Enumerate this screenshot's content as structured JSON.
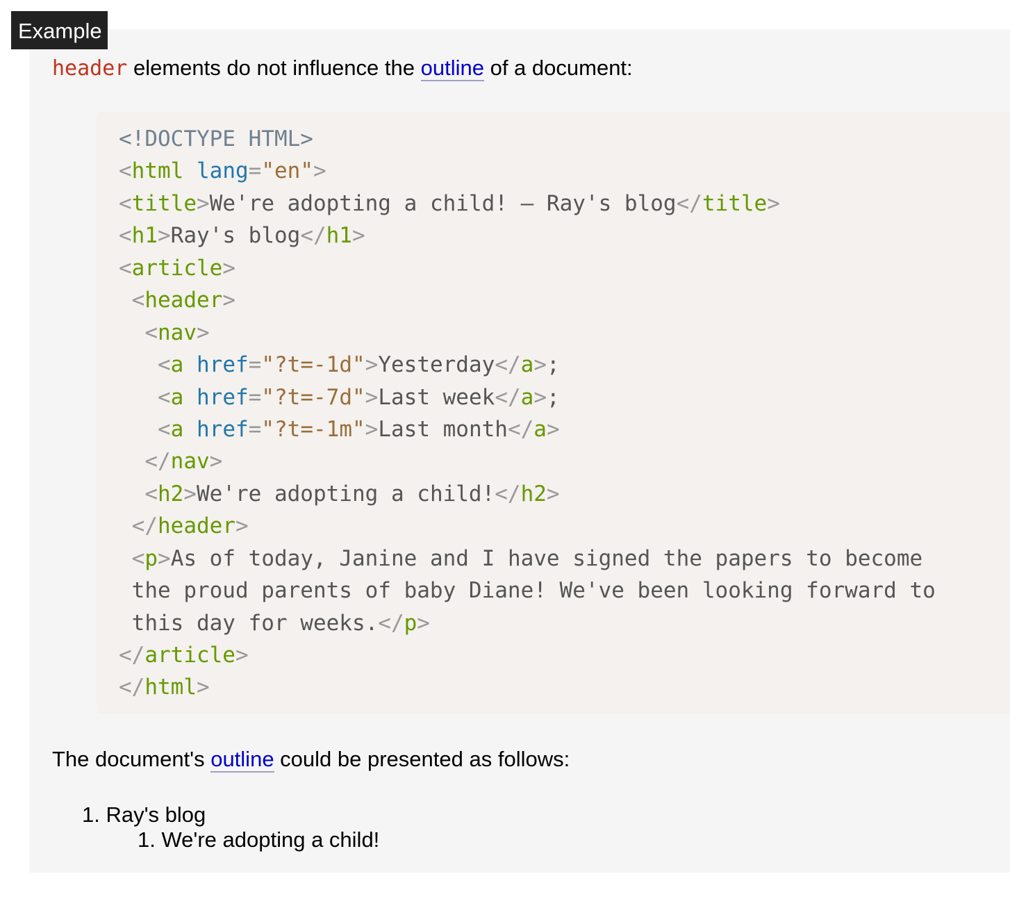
{
  "example_label": "Example",
  "intro": {
    "code_word": "header",
    "text_before_link": " elements do not influence the ",
    "link": "outline",
    "text_after_link": " of a document:"
  },
  "code_lines": [
    [
      {
        "c": "c-doc",
        "t": "<!DOCTYPE HTML>"
      }
    ],
    [
      {
        "c": "c-p",
        "t": "<"
      },
      {
        "c": "c-tag",
        "t": "html"
      },
      {
        "c": "c-txt",
        "t": " "
      },
      {
        "c": "c-attr",
        "t": "lang"
      },
      {
        "c": "c-p",
        "t": "="
      },
      {
        "c": "c-val",
        "t": "\"en\""
      },
      {
        "c": "c-p",
        "t": ">"
      }
    ],
    [
      {
        "c": "c-p",
        "t": "<"
      },
      {
        "c": "c-tag",
        "t": "title"
      },
      {
        "c": "c-p",
        "t": ">"
      },
      {
        "c": "c-txt",
        "t": "We're adopting a child! — Ray's blog"
      },
      {
        "c": "c-p",
        "t": "</"
      },
      {
        "c": "c-tag",
        "t": "title"
      },
      {
        "c": "c-p",
        "t": ">"
      }
    ],
    [
      {
        "c": "c-p",
        "t": "<"
      },
      {
        "c": "c-tag",
        "t": "h1"
      },
      {
        "c": "c-p",
        "t": ">"
      },
      {
        "c": "c-txt",
        "t": "Ray's blog"
      },
      {
        "c": "c-p",
        "t": "</"
      },
      {
        "c": "c-tag",
        "t": "h1"
      },
      {
        "c": "c-p",
        "t": ">"
      }
    ],
    [
      {
        "c": "c-p",
        "t": "<"
      },
      {
        "c": "c-tag",
        "t": "article"
      },
      {
        "c": "c-p",
        "t": ">"
      }
    ],
    [
      {
        "c": "c-txt",
        "t": " "
      },
      {
        "c": "c-p",
        "t": "<"
      },
      {
        "c": "c-tag",
        "t": "header"
      },
      {
        "c": "c-p",
        "t": ">"
      }
    ],
    [
      {
        "c": "c-txt",
        "t": "  "
      },
      {
        "c": "c-p",
        "t": "<"
      },
      {
        "c": "c-tag",
        "t": "nav"
      },
      {
        "c": "c-p",
        "t": ">"
      }
    ],
    [
      {
        "c": "c-txt",
        "t": "   "
      },
      {
        "c": "c-p",
        "t": "<"
      },
      {
        "c": "c-tag",
        "t": "a"
      },
      {
        "c": "c-txt",
        "t": " "
      },
      {
        "c": "c-attr",
        "t": "href"
      },
      {
        "c": "c-p",
        "t": "="
      },
      {
        "c": "c-val",
        "t": "\"?t=-1d\""
      },
      {
        "c": "c-p",
        "t": ">"
      },
      {
        "c": "c-txt",
        "t": "Yesterday"
      },
      {
        "c": "c-p",
        "t": "</"
      },
      {
        "c": "c-tag",
        "t": "a"
      },
      {
        "c": "c-p",
        "t": ">"
      },
      {
        "c": "c-txt",
        "t": ";"
      }
    ],
    [
      {
        "c": "c-txt",
        "t": "   "
      },
      {
        "c": "c-p",
        "t": "<"
      },
      {
        "c": "c-tag",
        "t": "a"
      },
      {
        "c": "c-txt",
        "t": " "
      },
      {
        "c": "c-attr",
        "t": "href"
      },
      {
        "c": "c-p",
        "t": "="
      },
      {
        "c": "c-val",
        "t": "\"?t=-7d\""
      },
      {
        "c": "c-p",
        "t": ">"
      },
      {
        "c": "c-txt",
        "t": "Last week"
      },
      {
        "c": "c-p",
        "t": "</"
      },
      {
        "c": "c-tag",
        "t": "a"
      },
      {
        "c": "c-p",
        "t": ">"
      },
      {
        "c": "c-txt",
        "t": ";"
      }
    ],
    [
      {
        "c": "c-txt",
        "t": "   "
      },
      {
        "c": "c-p",
        "t": "<"
      },
      {
        "c": "c-tag",
        "t": "a"
      },
      {
        "c": "c-txt",
        "t": " "
      },
      {
        "c": "c-attr",
        "t": "href"
      },
      {
        "c": "c-p",
        "t": "="
      },
      {
        "c": "c-val",
        "t": "\"?t=-1m\""
      },
      {
        "c": "c-p",
        "t": ">"
      },
      {
        "c": "c-txt",
        "t": "Last month"
      },
      {
        "c": "c-p",
        "t": "</"
      },
      {
        "c": "c-tag",
        "t": "a"
      },
      {
        "c": "c-p",
        "t": ">"
      }
    ],
    [
      {
        "c": "c-txt",
        "t": "  "
      },
      {
        "c": "c-p",
        "t": "</"
      },
      {
        "c": "c-tag",
        "t": "nav"
      },
      {
        "c": "c-p",
        "t": ">"
      }
    ],
    [
      {
        "c": "c-txt",
        "t": "  "
      },
      {
        "c": "c-p",
        "t": "<"
      },
      {
        "c": "c-tag",
        "t": "h2"
      },
      {
        "c": "c-p",
        "t": ">"
      },
      {
        "c": "c-txt",
        "t": "We're adopting a child!"
      },
      {
        "c": "c-p",
        "t": "</"
      },
      {
        "c": "c-tag",
        "t": "h2"
      },
      {
        "c": "c-p",
        "t": ">"
      }
    ],
    [
      {
        "c": "c-txt",
        "t": " "
      },
      {
        "c": "c-p",
        "t": "</"
      },
      {
        "c": "c-tag",
        "t": "header"
      },
      {
        "c": "c-p",
        "t": ">"
      }
    ],
    [
      {
        "c": "c-txt",
        "t": " "
      },
      {
        "c": "c-p",
        "t": "<"
      },
      {
        "c": "c-tag",
        "t": "p"
      },
      {
        "c": "c-p",
        "t": ">"
      },
      {
        "c": "c-txt",
        "t": "As of today, Janine and I have signed the papers to become"
      }
    ],
    [
      {
        "c": "c-txt",
        "t": " the proud parents of baby Diane! We've been looking forward to"
      }
    ],
    [
      {
        "c": "c-txt",
        "t": " this day for weeks."
      },
      {
        "c": "c-p",
        "t": "</"
      },
      {
        "c": "c-tag",
        "t": "p"
      },
      {
        "c": "c-p",
        "t": ">"
      }
    ],
    [
      {
        "c": "c-p",
        "t": "</"
      },
      {
        "c": "c-tag",
        "t": "article"
      },
      {
        "c": "c-p",
        "t": ">"
      }
    ],
    [
      {
        "c": "c-p",
        "t": "</"
      },
      {
        "c": "c-tag",
        "t": "html"
      },
      {
        "c": "c-p",
        "t": ">"
      }
    ]
  ],
  "outline_intro": {
    "text_before_link": "The document's ",
    "link": "outline",
    "text_after_link": " could be presented as follows:"
  },
  "outline": {
    "item_1_number": "1.",
    "item_1_label": "Ray's blog",
    "item_1_1_number": "1.",
    "item_1_1_label": "We're adopting a child!"
  }
}
